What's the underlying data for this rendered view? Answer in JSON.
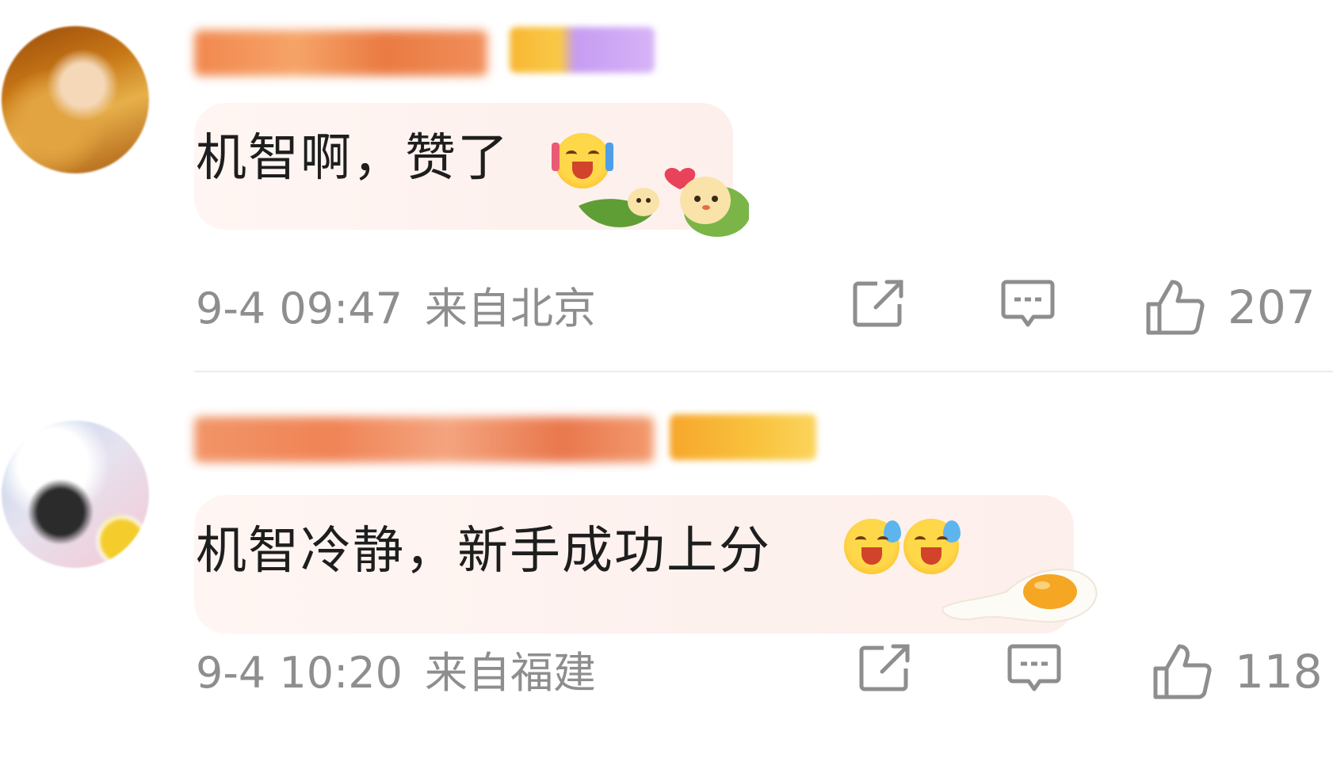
{
  "comments": [
    {
      "text": "机智啊，赞了",
      "time": "9-4 09:47",
      "location": "来自北京",
      "likes": "207",
      "emojis": [
        "cheering-emoji-icon"
      ],
      "decoration": "zongzi-sticker"
    },
    {
      "text": "机智冷静，新手成功上分",
      "time": "9-4 10:20",
      "location": "来自福建",
      "likes": "118",
      "emojis": [
        "laugh-cry-emoji-icon",
        "laugh-cry-emoji-icon"
      ],
      "decoration": "fried-egg-sticker"
    }
  ],
  "icons": {
    "share": "share-icon",
    "reply": "comment-icon",
    "like": "thumbs-up-icon"
  },
  "colors": {
    "text": "#1e1e1e",
    "meta": "#8e8e8e",
    "bubble": "#fdf1ee",
    "divider": "#ececec"
  }
}
